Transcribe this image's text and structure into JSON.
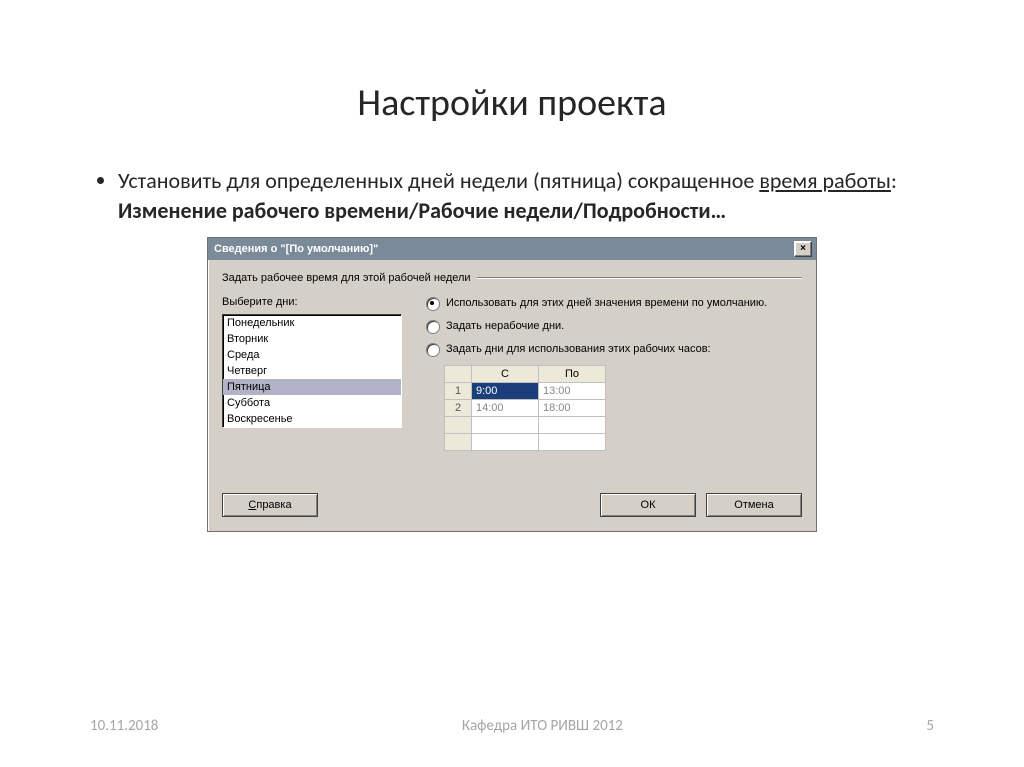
{
  "slide": {
    "title": "Настройки проекта",
    "bullet_prefix": "Установить для определенных дней недели (пятница) сокращенное ",
    "bullet_underlined": "время работы",
    "bullet_colon": ": ",
    "bullet_bold": "Изменение рабочего времени/Рабочие недели/Подробности…"
  },
  "dialog": {
    "title": "Сведения о \"[По умолчанию]\"",
    "close_x": "×",
    "group_caption": "Задать рабочее время для этой рабочей недели",
    "days_label": "Выберите дни:",
    "days": [
      "Понедельник",
      "Вторник",
      "Среда",
      "Четверг",
      "Пятница",
      "Суббота",
      "Воскресенье"
    ],
    "selected_day_index": 4,
    "radios": [
      {
        "label": "Использовать для этих дней значения времени по умолчанию.",
        "checked": true
      },
      {
        "label": "Задать нерабочие дни.",
        "checked": false
      },
      {
        "label": "Задать дни для использования этих рабочих часов:",
        "checked": false
      }
    ],
    "table": {
      "headers": {
        "from": "С",
        "to": "По"
      },
      "rows": [
        {
          "num": "1",
          "from": "9:00",
          "to": "13:00",
          "from_selected": true
        },
        {
          "num": "2",
          "from": "14:00",
          "to": "18:00"
        },
        {
          "num": "",
          "from": "",
          "to": ""
        },
        {
          "num": "",
          "from": "",
          "to": ""
        }
      ]
    },
    "buttons": {
      "help_first": "С",
      "help_rest": "правка",
      "ok": "ОК",
      "cancel": "Отмена"
    }
  },
  "footer": {
    "date": "10.11.2018",
    "center": "Кафедра ИТО РИВШ 2012",
    "page": "5"
  }
}
